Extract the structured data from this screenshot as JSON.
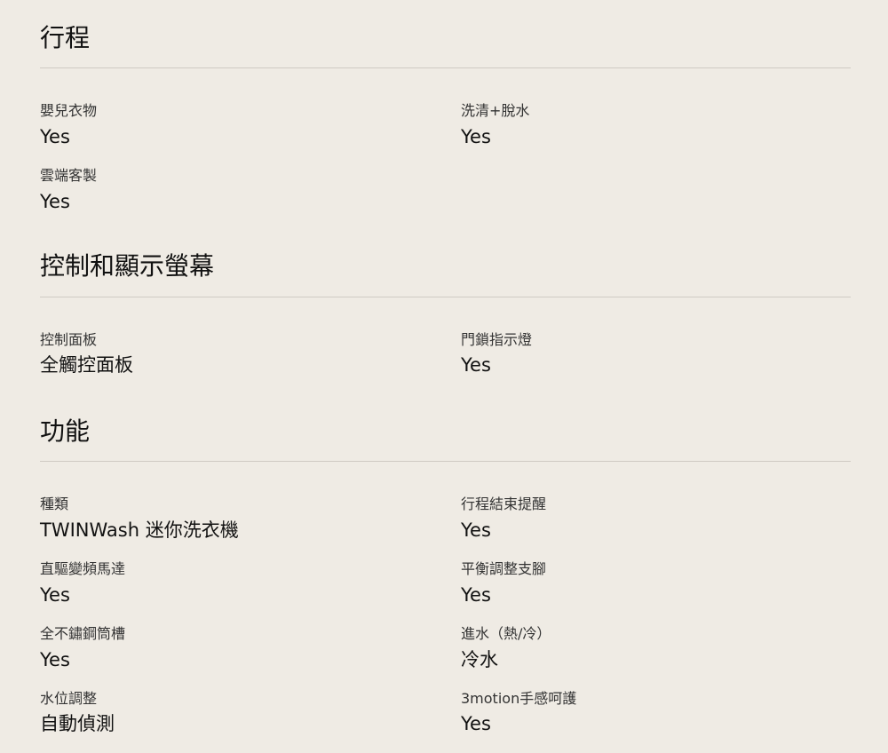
{
  "sections": [
    {
      "title": "行程",
      "items": [
        {
          "label": "嬰兒衣物",
          "value": "Yes"
        },
        {
          "label": "洗清+脫水",
          "value": "Yes"
        },
        {
          "label": "雲端客製",
          "value": "Yes"
        }
      ]
    },
    {
      "title": "控制和顯示螢幕",
      "items": [
        {
          "label": "控制面板",
          "value": "全觸控面板"
        },
        {
          "label": "門鎖指示燈",
          "value": "Yes"
        }
      ]
    },
    {
      "title": "功能",
      "items": [
        {
          "label": "種類",
          "value": "TWINWash 迷你洗衣機"
        },
        {
          "label": "行程結束提醒",
          "value": "Yes"
        },
        {
          "label": "直驅變頻馬達",
          "value": "Yes"
        },
        {
          "label": "平衡調整支腳",
          "value": "Yes"
        },
        {
          "label": "全不鏽鋼筒槽",
          "value": "Yes"
        },
        {
          "label": "進水（熱/冷）",
          "value": "冷水"
        },
        {
          "label": "水位調整",
          "value": "自動偵測"
        },
        {
          "label": "3motion手感呵護",
          "value": "Yes"
        }
      ]
    }
  ]
}
